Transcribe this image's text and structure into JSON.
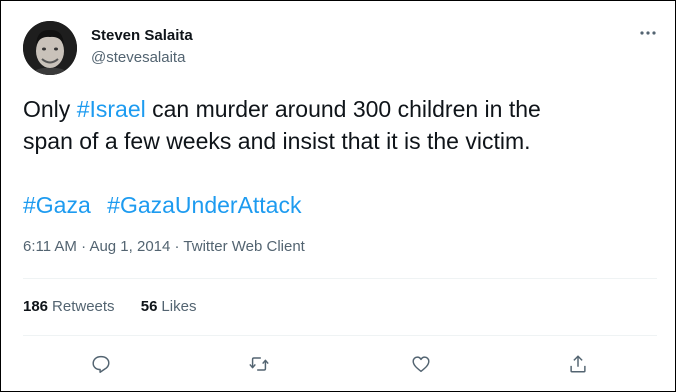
{
  "author": {
    "name": "Steven Salaita",
    "handle": "@stevesalaita"
  },
  "tweet": {
    "line1_pre": "Only ",
    "line1_tag": "#Israel",
    "line1_post": " can murder around 300 children in the",
    "line2": "span of a few weeks and insist that it is the victim.",
    "hashtags": [
      "#Gaza",
      "#GazaUnderAttack"
    ]
  },
  "meta": {
    "time": "6:11 AM",
    "separator": " · ",
    "date": "Aug 1, 2014",
    "client": "Twitter Web Client"
  },
  "stats": {
    "retweets_count": "186",
    "retweets_label": "Retweets",
    "likes_count": "56",
    "likes_label": "Likes"
  },
  "icons": {
    "more": "more-dots-icon",
    "reply": "reply-icon",
    "retweet": "retweet-icon",
    "like": "heart-icon",
    "share": "share-icon"
  },
  "colors": {
    "link": "#1d9bf0",
    "secondary_text": "#536471",
    "primary_text": "#0f1419"
  }
}
